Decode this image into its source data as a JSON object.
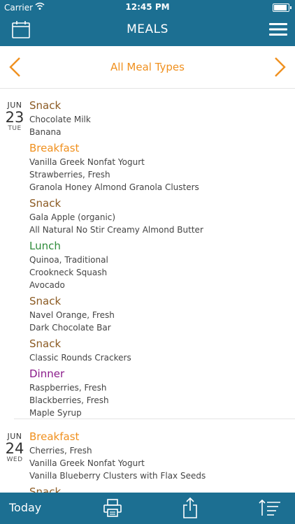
{
  "status": {
    "carrier": "Carrier",
    "time": "12:45 PM"
  },
  "header": {
    "title": "MEALS",
    "left_icon": "calendar-icon",
    "right_icon": "menu-icon"
  },
  "filter": {
    "label": "All Meal Types",
    "prev_icon": "chevron-left-icon",
    "next_icon": "chevron-right-icon"
  },
  "days": [
    {
      "month": "JUN",
      "day": "23",
      "weekday": "TUE",
      "meals": [
        {
          "name": "Snack",
          "items": [
            "Chocolate Milk",
            "Banana"
          ]
        },
        {
          "name": "Breakfast",
          "items": [
            "Vanilla Greek Nonfat Yogurt",
            "Strawberries, Fresh",
            "Granola Honey Almond Granola Clusters"
          ]
        },
        {
          "name": "Snack",
          "items": [
            "Gala Apple (organic)",
            "All Natural No Stir Creamy Almond Butter"
          ]
        },
        {
          "name": "Lunch",
          "items": [
            "Quinoa, Traditional",
            "Crookneck Squash",
            "Avocado"
          ]
        },
        {
          "name": "Snack",
          "items": [
            "Navel Orange, Fresh",
            "Dark Chocolate Bar"
          ]
        },
        {
          "name": "Snack",
          "items": [
            "Classic Rounds Crackers"
          ]
        },
        {
          "name": "Dinner",
          "items": [
            "Raspberries, Fresh",
            "Blackberries, Fresh",
            "Maple Syrup"
          ]
        }
      ]
    },
    {
      "month": "JUN",
      "day": "24",
      "weekday": "WED",
      "meals": [
        {
          "name": "Breakfast",
          "items": [
            "Cherries, Fresh",
            "Vanilla Greek Nonfat Yogurt",
            "Vanilla Blueberry Clusters with Flax Seeds"
          ]
        },
        {
          "name": "Snack",
          "items": []
        }
      ]
    }
  ],
  "toolbar": {
    "today_label": "Today",
    "print_icon": "print-icon",
    "share_icon": "share-icon",
    "sort_icon": "sort-icon"
  },
  "colors": {
    "bar": "#1c6f92",
    "accent": "#f0901e",
    "snack": "#8b5a22",
    "breakfast": "#f0901e",
    "lunch": "#2e8b3a",
    "dinner": "#8a1a8a"
  }
}
